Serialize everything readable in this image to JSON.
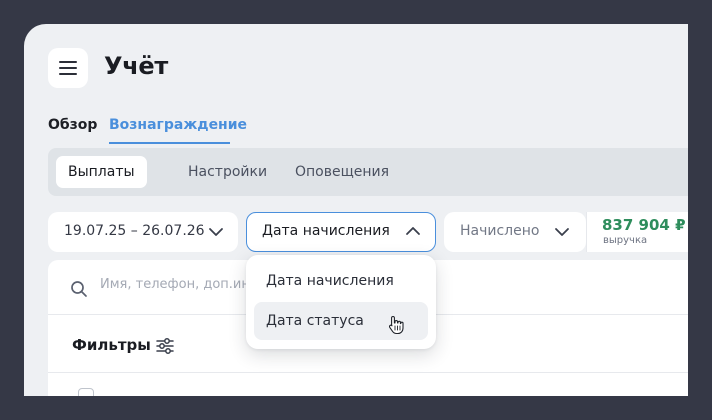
{
  "header": {
    "title": "Учёт",
    "menu_icon": "hamburger-icon"
  },
  "tabs": [
    {
      "label": "Обзор",
      "active": false
    },
    {
      "label": "Вознаграждение",
      "active": true
    }
  ],
  "segments": [
    {
      "label": "Выплаты",
      "active": true
    },
    {
      "label": "Настройки",
      "active": false
    },
    {
      "label": "Оповещения",
      "active": false
    }
  ],
  "filters": {
    "date_range": "19.07.25 – 26.07.26",
    "sort_by": "Дата начисления",
    "status": "Начислено"
  },
  "revenue": {
    "value": "837 904 ₽",
    "label": "выручка",
    "color": "#2e8d5c"
  },
  "search": {
    "placeholder": "Имя, телефон, доп.инф"
  },
  "filters_panel": {
    "title": "Фильтры"
  },
  "dropdown": {
    "options": [
      {
        "label": "Дата начисления"
      },
      {
        "label": "Дата статуса",
        "hovered": true
      }
    ]
  },
  "colors": {
    "accent": "#4a8fdc",
    "background": "#353846",
    "surface": "#eef0f3"
  }
}
